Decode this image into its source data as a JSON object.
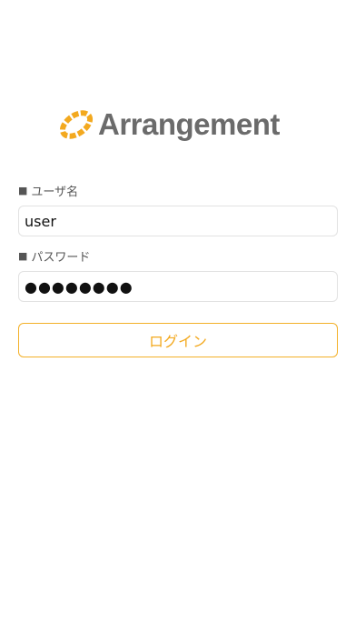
{
  "app": {
    "logo_text": "Arrangement",
    "accent_color": "#f3a91f"
  },
  "form": {
    "username": {
      "label_prefix": "■",
      "label": "ユーザ名",
      "value": "user"
    },
    "password": {
      "label_prefix": "■",
      "label": "パスワード",
      "value": "●●●●●●●●"
    },
    "login_button_label": "ログイン"
  }
}
